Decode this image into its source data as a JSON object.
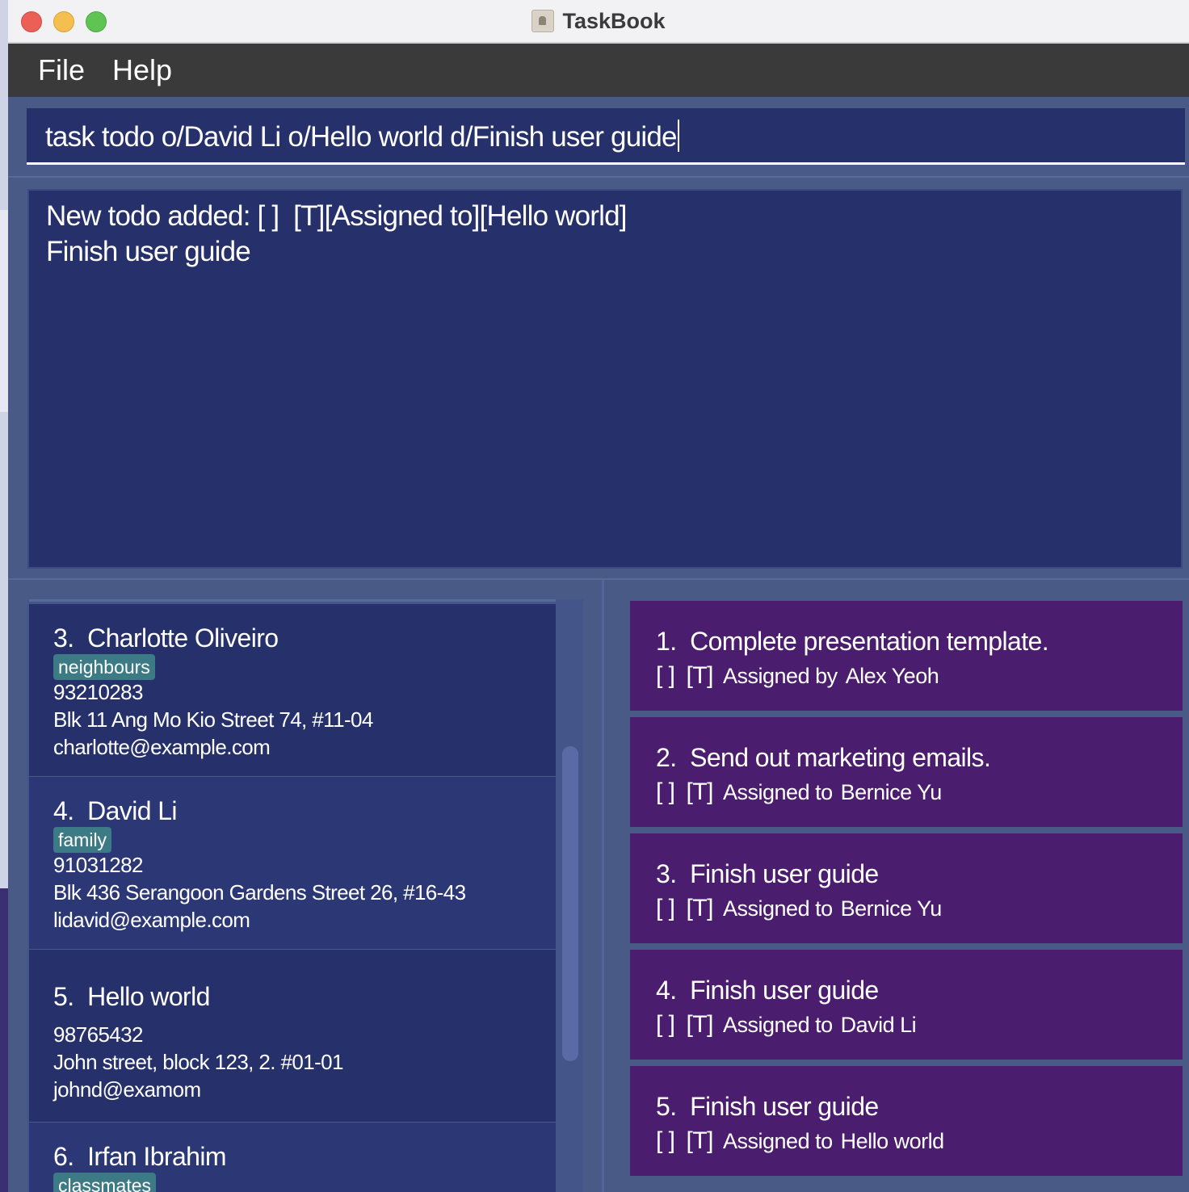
{
  "window": {
    "title": "TaskBook"
  },
  "menu": {
    "file": "File",
    "help": "Help"
  },
  "command": {
    "value": "task todo o/David Li o/Hello world d/Finish user guide"
  },
  "result": {
    "text": "New todo added: [ ]  [T][Assigned to][Hello world]\nFinish user guide"
  },
  "persons": [
    {
      "index": "3.",
      "name": "Charlotte Oliveiro",
      "tag": "neighbours",
      "phone": "93210283",
      "address": "Blk 11 Ang Mo Kio Street 74, #11-04",
      "email": "charlotte@example.com"
    },
    {
      "index": "4.",
      "name": "David Li",
      "tag": "family",
      "phone": "91031282",
      "address": "Blk 436 Serangoon Gardens Street 26, #16-43",
      "email": "lidavid@example.com"
    },
    {
      "index": "5.",
      "name": "Hello world",
      "phone": "98765432",
      "address": "John street, block 123, 2. #01-01",
      "email": "johnd@examom"
    },
    {
      "index": "6.",
      "name": "Irfan Ibrahim",
      "tag": "classmates"
    }
  ],
  "tasks": [
    {
      "index": "1.",
      "title": "Complete presentation template.",
      "status": "[ ]",
      "type": "[T]",
      "relation": "Assigned by",
      "who": "Alex Yeoh"
    },
    {
      "index": "2.",
      "title": "Send out marketing emails.",
      "status": "[ ]",
      "type": "[T]",
      "relation": "Assigned to",
      "who": "Bernice Yu"
    },
    {
      "index": "3.",
      "title": "Finish user guide",
      "status": "[ ]",
      "type": "[T]",
      "relation": "Assigned to",
      "who": "Bernice Yu"
    },
    {
      "index": "4.",
      "title": "Finish user guide",
      "status": "[ ]",
      "type": "[T]",
      "relation": "Assigned to",
      "who": "David Li"
    },
    {
      "index": "5.",
      "title": "Finish user guide",
      "status": "[ ]",
      "type": "[T]",
      "relation": "Assigned to",
      "who": "Hello world"
    }
  ],
  "colors": {
    "menubar": "#3a3a3a",
    "panel_bg": "#26306b",
    "task_card": "#4b1d6e",
    "tag_bg": "#3c7a86",
    "window_bg": "#4a5a87"
  }
}
